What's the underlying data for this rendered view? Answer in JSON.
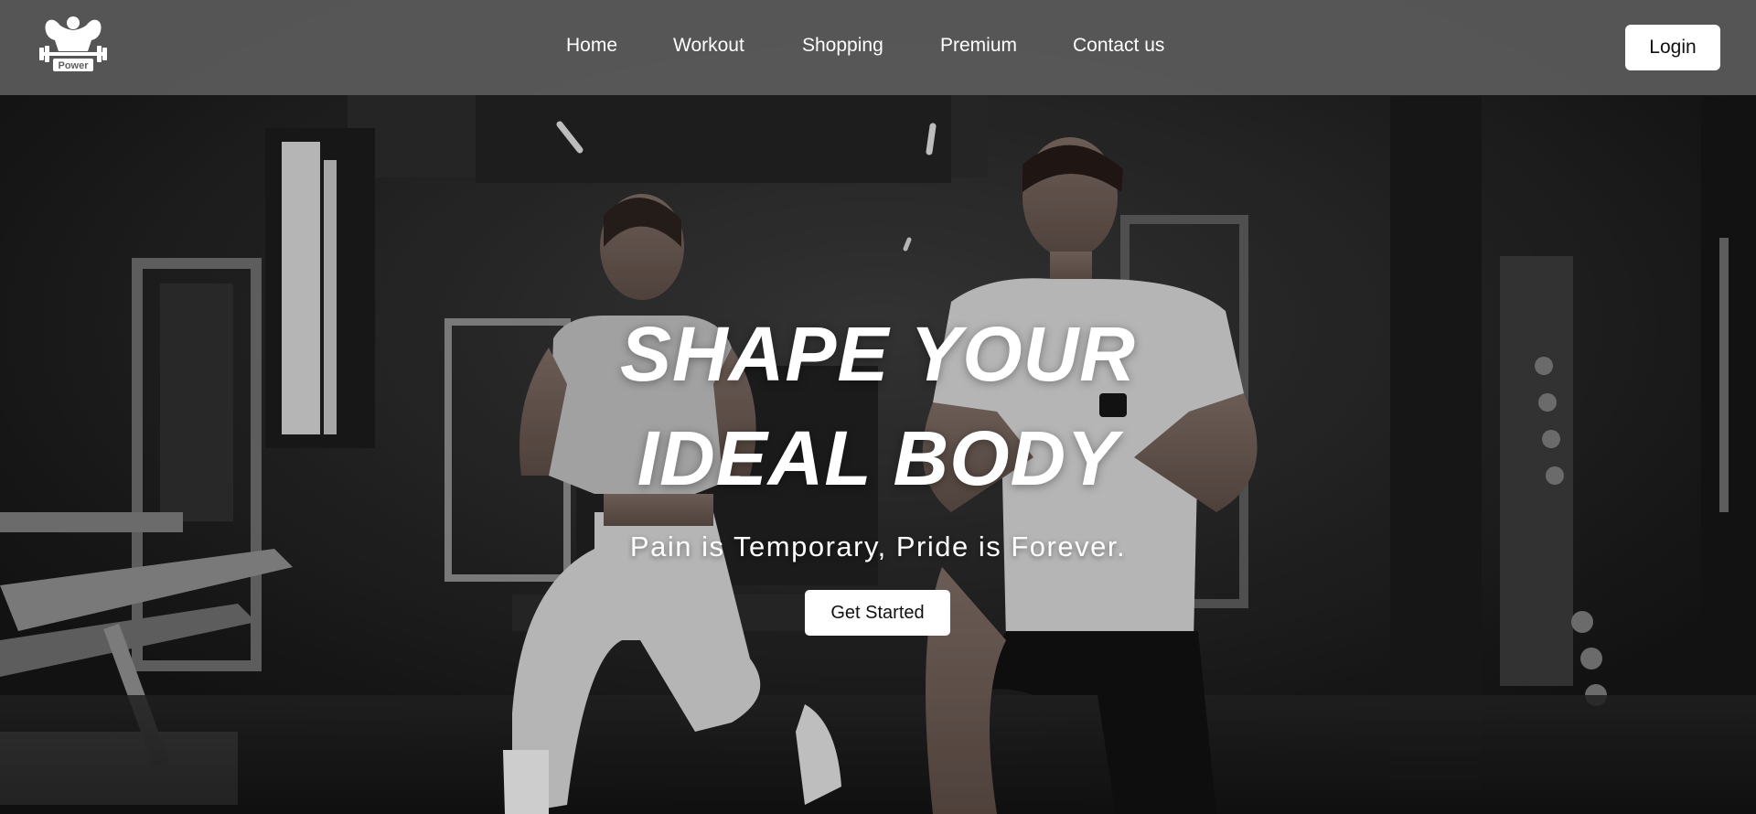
{
  "brand": {
    "logo_text": "Power",
    "logo_icon": "bodybuilder-barbell-icon"
  },
  "nav": {
    "items": [
      {
        "label": "Home"
      },
      {
        "label": "Workout"
      },
      {
        "label": "Shopping"
      },
      {
        "label": "Premium"
      },
      {
        "label": "Contact us"
      }
    ],
    "login_label": "Login"
  },
  "hero": {
    "title_line1": "SHAPE YOUR",
    "title_line2": "IDEAL BODY",
    "subtitle": "Pain is Temporary, Pride is Forever.",
    "cta_label": "Get Started",
    "background": "gym-photo-two-people-lunging"
  },
  "colors": {
    "navbar_bg": "#5f5f5f",
    "button_bg": "#ffffff",
    "text_light": "#ffffff",
    "scene_dark": "#1d1d1d"
  }
}
